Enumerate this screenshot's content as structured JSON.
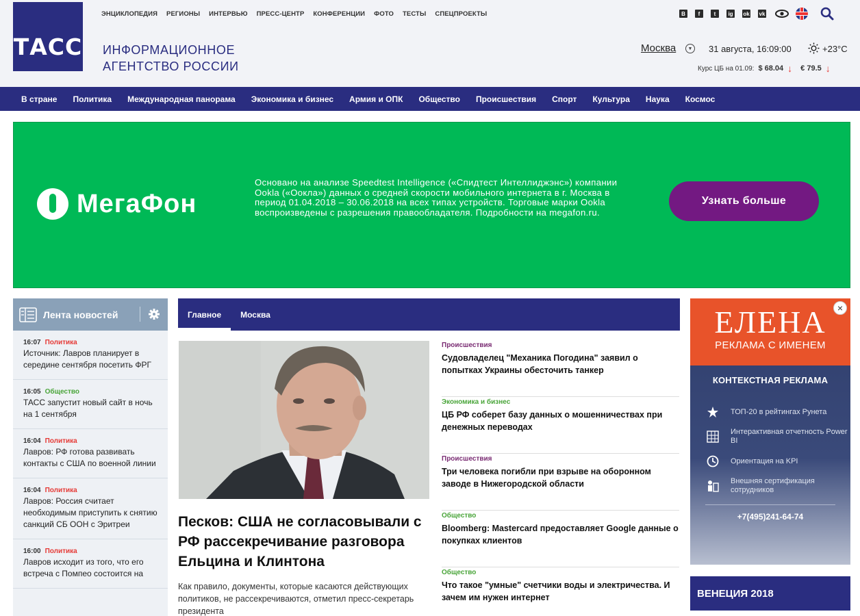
{
  "header": {
    "logo_text": "ТАСС",
    "agency_line1": "ИНФОРМАЦИОННОЕ",
    "agency_line2": "АГЕНТСТВО РОССИИ",
    "top_links": [
      "ЭНЦИКЛОПЕДИЯ",
      "РЕГИОНЫ",
      "ИНТЕРВЬЮ",
      "ПРЕСС-ЦЕНТР",
      "КОНФЕРЕНЦИИ",
      "ФОТО",
      "ТЕСТЫ",
      "СПЕЦПРОЕКТЫ"
    ],
    "social": [
      "В",
      "f",
      "t",
      "ig",
      "ok",
      "vk"
    ],
    "city": "Москва",
    "datetime": "31 августа, 16:09:00",
    "temperature": "+23°C",
    "rates_label": "Курс ЦБ на 01.09:",
    "usd": "$ 68.04",
    "eur": "€ 79.5",
    "rate_arrow": "↓"
  },
  "main_nav": [
    "В стране",
    "Политика",
    "Международная панорама",
    "Экономика и бизнес",
    "Армия и ОПК",
    "Общество",
    "Происшествия",
    "Спорт",
    "Культура",
    "Наука",
    "Космос"
  ],
  "banner": {
    "brand": "МегаФон",
    "disclaimer": "Основано на анализе Speedtest Intelligence («Спидтест Интеллиджэнс») компании Ookla («Оокла») данных о средней скорости мобильного интернета в г. Москва в период 01.04.2018 – 30.06.2018 на всех типах устройств. Торговые марки Ookla воспроизведены с разрешения правообладателя. Подробности на megafon.ru.",
    "button": "Узнать больше"
  },
  "feed": {
    "title": "Лента новостей",
    "items": [
      {
        "time": "16:07",
        "cat": "Политика",
        "text": "Источник: Лавров планирует в середине сентября посетить ФРГ"
      },
      {
        "time": "16:05",
        "cat": "Общество",
        "text": "ТАСС запустит новый сайт в ночь на 1 сентября"
      },
      {
        "time": "16:04",
        "cat": "Политика",
        "text": "Лавров: РФ готова развивать контакты с США по военной линии"
      },
      {
        "time": "16:04",
        "cat": "Политика",
        "text": "Лавров: Россия считает необходимым приступить к снятию санкций СБ ООН с Эритреи"
      },
      {
        "time": "16:00",
        "cat": "Политика",
        "text": "Лавров исходит из того, что его встреча с Помпео состоится на"
      }
    ]
  },
  "tabs": [
    "Главное",
    "Москва"
  ],
  "main_story": {
    "headline": "Песков: США не согласовывали с РФ рассекречивание разговора Ельцина и Клинтона",
    "lead": "Как правило, документы, которые касаются действующих политиков, не рассекречиваются, отметил пресс-секретарь президента"
  },
  "news_list": [
    {
      "cat": "Происшествия",
      "title": "Судовладелец \"Механика Погодина\" заявил о попытках Украины обесточить танкер"
    },
    {
      "cat": "Экономика и бизнес",
      "title": "ЦБ РФ соберет базу данных о мошенничествах при денежных переводах"
    },
    {
      "cat": "Происшествия",
      "title": "Три человека погибли при взрыве на оборонном заводе в Нижегородской области"
    },
    {
      "cat": "Общество",
      "title": "Bloomberg: Mastercard предоставляет Google данные о покупках клиентов"
    },
    {
      "cat": "Общество",
      "title": "Что такое \"умные\" счетчики воды и электричества. И зачем им нужен интернет"
    }
  ],
  "side_ad": {
    "name": "ЕЛЕНА",
    "sub": "РЕКЛАМА С ИМЕНЕМ",
    "ctx": "КОНТЕКСТНАЯ РЕКЛАМА",
    "features": [
      "ТОП-20 в рейтингах Рунета",
      "Интерактивная отчетность Power BI",
      "Ориентация на KPI",
      "Внешняя сертификация сотрудников"
    ],
    "phone": "+7(495)241-64-74",
    "close": "×"
  },
  "side_block": "ВЕНЕЦИЯ 2018",
  "colors": {
    "brand_navy": "#2a2d80",
    "megafon_green": "#00b956",
    "megafon_purple": "#731982",
    "politics_red": "#e53935",
    "society_green": "#4aa53a"
  }
}
